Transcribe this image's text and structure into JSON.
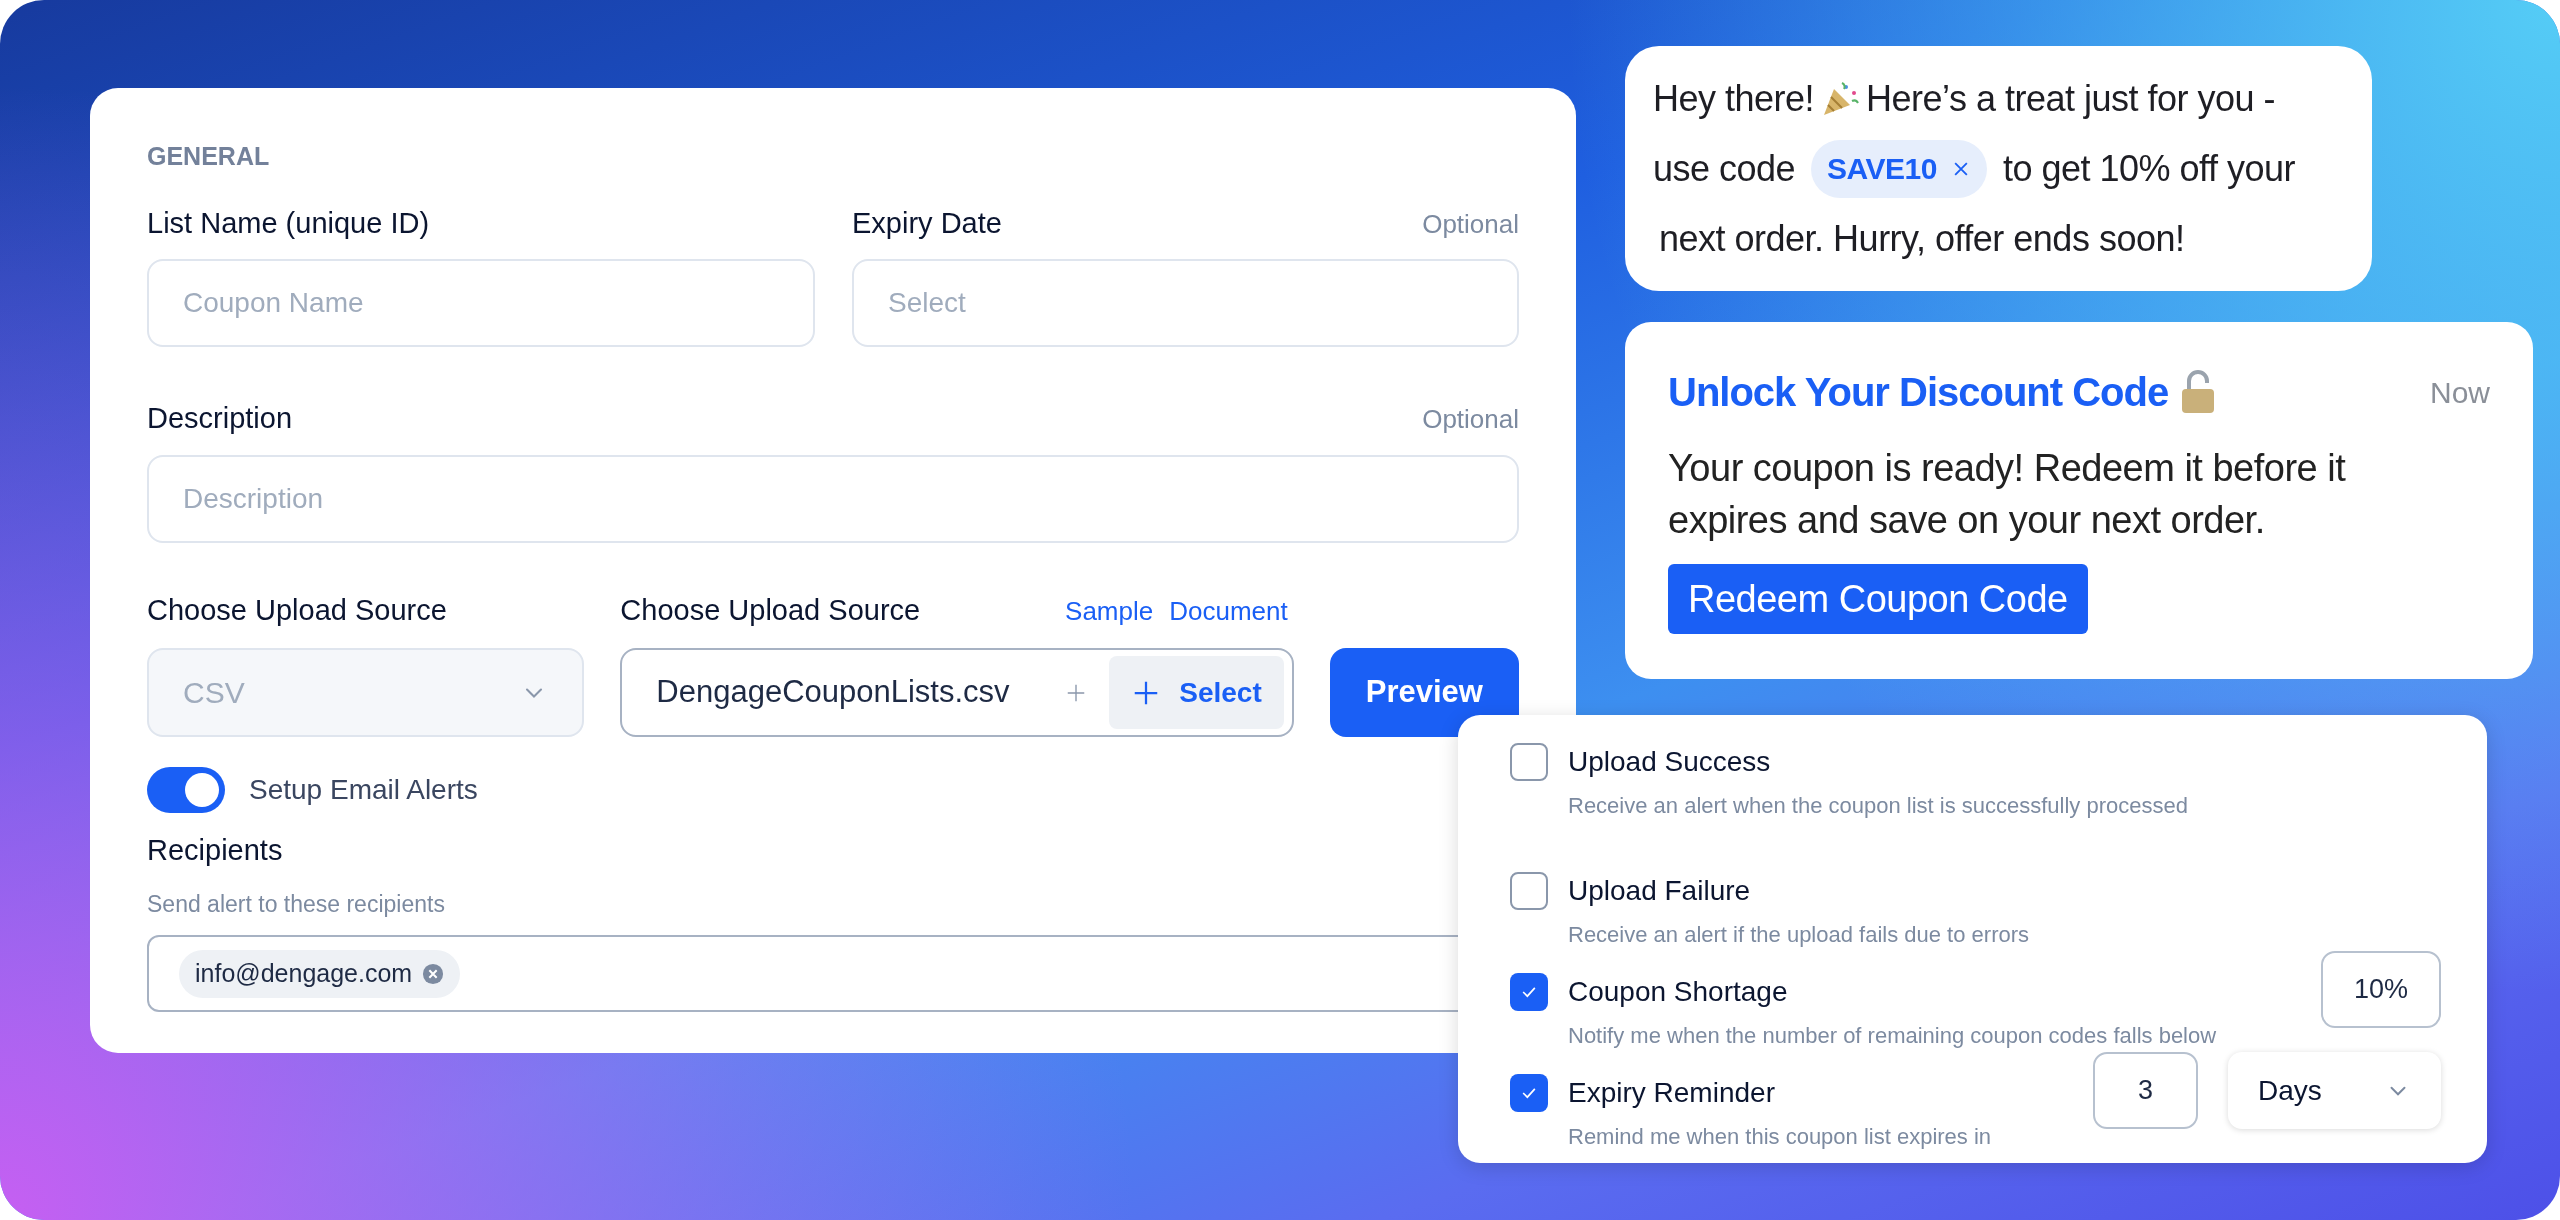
{
  "form": {
    "section": "GENERAL",
    "list_name": {
      "label": "List Name (unique ID)",
      "placeholder": "Coupon Name"
    },
    "expiry": {
      "label": "Expiry Date",
      "note": "Optional",
      "placeholder": "Select"
    },
    "description": {
      "label": "Description",
      "note": "Optional",
      "placeholder": "Description"
    },
    "source": {
      "label": "Choose Upload Source",
      "value": "CSV",
      "disabled": true
    },
    "file": {
      "label": "Choose Upload Source",
      "links": [
        "Sample",
        "Document"
      ],
      "value": "DengageCouponLists.csv",
      "button": "Select"
    },
    "preview_button": "Preview",
    "email_alerts": {
      "label": "Setup Email Alerts",
      "on": true
    },
    "recipients": {
      "label": "Recipients",
      "hint": "Send alert to these recipients",
      "chips": [
        "info@dengage.com"
      ]
    }
  },
  "chat_bubble": {
    "greeting": "Hey there!",
    "line1": "Here’s a treat just for you -",
    "lead": "use code",
    "code": "SAVE10",
    "after": "to get 10% off your",
    "last": "next order. Hurry, offer ends soon!"
  },
  "notification": {
    "title": "Unlock Your Discount Code",
    "time": "Now",
    "body": "Your coupon is ready! Redeem it before it expires and save on your next order.",
    "button": "Redeem Coupon Code"
  },
  "alerts": [
    {
      "kind": "plain",
      "label": "Upload Success",
      "description": "Receive an alert when the coupon list is successfully processed",
      "checked": false
    },
    {
      "kind": "plain",
      "label": "Upload Failure",
      "description": "Receive an alert if the upload fails due to errors",
      "checked": false
    },
    {
      "kind": "percent",
      "label": "Coupon Shortage",
      "description": "Notify me when the number of remaining coupon codes falls below",
      "checked": true,
      "value": "10%"
    },
    {
      "kind": "duration",
      "label": "Expiry Reminder",
      "description": "Remind me when this coupon list expires in",
      "checked": true,
      "value": "3",
      "unit": "Days"
    }
  ]
}
